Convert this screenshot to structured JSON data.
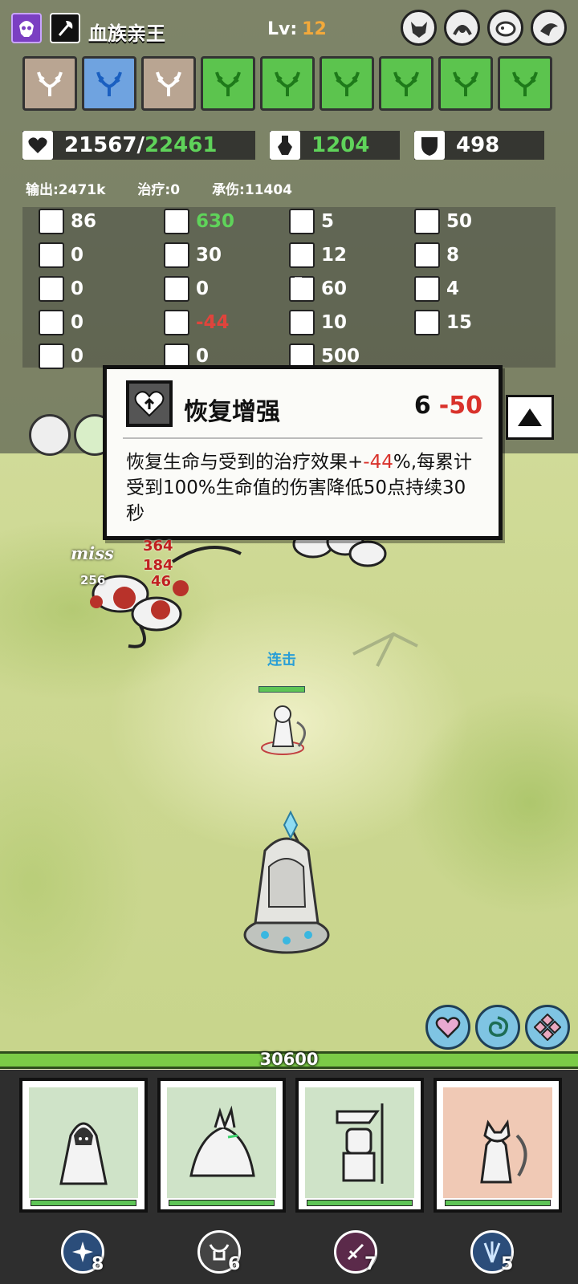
{
  "header": {
    "hero_name": "血族亲王",
    "level_label": "Lv:",
    "level_value": "12",
    "class_icon": "vampire-skull-icon",
    "weapon_icon": "axe-icon",
    "boss_icons": [
      "wolf-head-icon",
      "claw-monster-icon",
      "beast-icon",
      "crow-icon"
    ]
  },
  "skills": [
    {
      "icon": "antler-icon",
      "color": "tan"
    },
    {
      "icon": "antler-icon",
      "color": "blue"
    },
    {
      "icon": "antler-icon",
      "color": "tan"
    },
    {
      "icon": "antler-icon",
      "color": "green"
    },
    {
      "icon": "antler-icon",
      "color": "green"
    },
    {
      "icon": "antler-icon",
      "color": "green"
    },
    {
      "icon": "antler-icon",
      "color": "green"
    },
    {
      "icon": "antler-icon",
      "color": "green"
    },
    {
      "icon": "antler-icon",
      "color": "green"
    }
  ],
  "stats": {
    "hp_current": "21567/",
    "hp_max": "22461",
    "attack": "1204",
    "defense": "498"
  },
  "totals": {
    "output": "输出:2471k",
    "healing": "治疗:0",
    "damage_taken": "承伤:11404"
  },
  "attributes": {
    "col1": [
      {
        "icon": "heart-plus-icon",
        "value": "86",
        "tone": "white"
      },
      {
        "icon": "shield-person-icon",
        "value": "0",
        "tone": "white"
      },
      {
        "icon": "cooldown-icon",
        "value": "0",
        "tone": "white"
      },
      {
        "icon": "hook-icon",
        "value": "0",
        "tone": "white"
      },
      {
        "icon": "lightning-shield-icon",
        "value": "0",
        "tone": "white"
      }
    ],
    "col2": [
      {
        "icon": "slash-icon",
        "value": "630",
        "tone": "green"
      },
      {
        "icon": "swords-icon",
        "value": "30",
        "tone": "white"
      },
      {
        "icon": "dodge-icon",
        "value": "0",
        "tone": "white"
      },
      {
        "icon": "heal-boost-icon",
        "value": "-44",
        "tone": "red"
      },
      {
        "icon": "bolt-icon",
        "value": "0",
        "tone": "white"
      }
    ],
    "col3": [
      {
        "icon": "flame-icon",
        "value": "5",
        "tone": "white"
      },
      {
        "icon": "crit-icon",
        "value": "12",
        "tone": "white"
      },
      {
        "icon": "boot-icon",
        "value": "60",
        "tone": "white"
      },
      {
        "icon": "cross-icon",
        "value": "10",
        "tone": "white"
      },
      {
        "icon": "tower-icon",
        "value": "500",
        "tone": "white"
      }
    ],
    "col4": [
      {
        "icon": "burst-icon",
        "value": "50",
        "tone": "white"
      },
      {
        "icon": "vortex-icon",
        "value": "8",
        "tone": "white"
      },
      {
        "icon": "bone-icon",
        "value": "4",
        "tone": "white"
      },
      {
        "icon": "timer-icon",
        "value": "15",
        "tone": "white"
      }
    ]
  },
  "tooltip": {
    "icon": "heal-boost-icon",
    "title": "恢复增强",
    "level_current": "6",
    "level_delta": "-50",
    "desc_part1": "恢复生命与受到的治疗效果+",
    "desc_red": "-44",
    "desc_part2": "%,每累计受到100%生命值的伤害降低50点持续30秒"
  },
  "battle": {
    "miss_text": "miss",
    "damage_numbers": [
      "364",
      "184",
      "46",
      "256"
    ],
    "combo_text": "连击"
  },
  "abilities": [
    "heart-icon",
    "swirl-icon",
    "dpad-icon"
  ],
  "base_hp": "30600",
  "cards": [
    {
      "name": "hooded-mage",
      "bg": "#cfe3c8"
    },
    {
      "name": "spiked-beast",
      "bg": "#cfe3c8"
    },
    {
      "name": "knight-banner",
      "bg": "#cfe3c8"
    },
    {
      "name": "cat-archer",
      "bg": "#f0c9b5"
    }
  ],
  "runes": [
    {
      "icon": "feather-burst-icon",
      "count": "8"
    },
    {
      "icon": "horned-skull-icon",
      "count": "6"
    },
    {
      "icon": "blade-icon",
      "count": "7"
    },
    {
      "icon": "feather-spread-icon",
      "count": "5"
    }
  ]
}
